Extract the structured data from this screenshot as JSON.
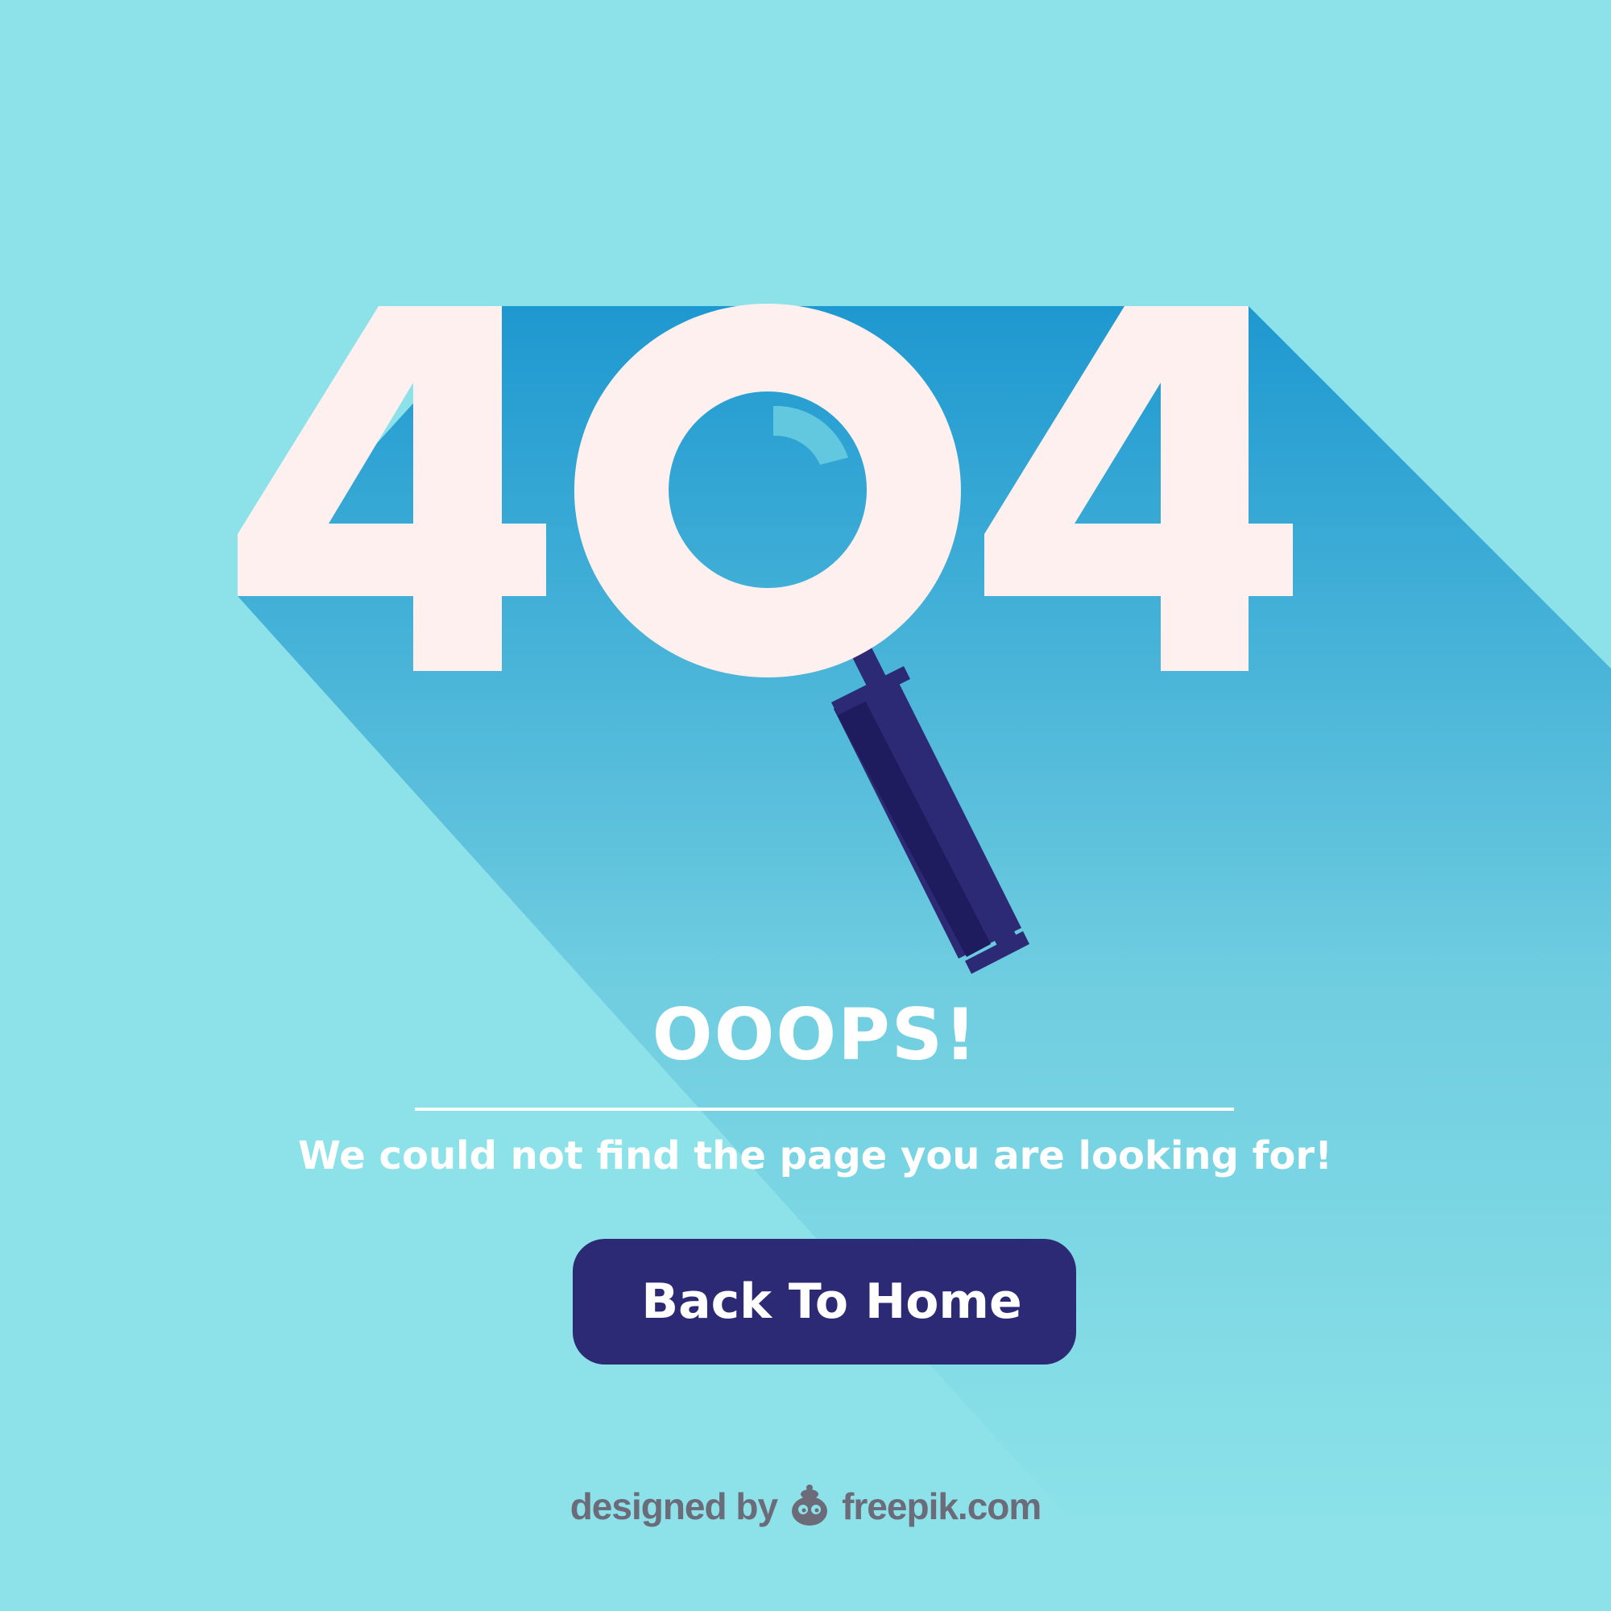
{
  "hero": {
    "code_digits": [
      "4",
      "0",
      "4"
    ]
  },
  "content": {
    "heading": "OOOPS!",
    "message": "We could not find the page you are looking for!",
    "home_button_label": "Back To Home"
  },
  "credit": {
    "prefix": "designed by",
    "brand": "freepik.com",
    "logo_icon": "freepik-logo-icon"
  },
  "colors": {
    "background": "#8ce2e8",
    "digits": "#fff0f0",
    "shadow_top": "#1e98d0",
    "button": "#2d2a75",
    "handle_dark": "#1e1b5e",
    "credit_text": "#6b6b7a"
  }
}
